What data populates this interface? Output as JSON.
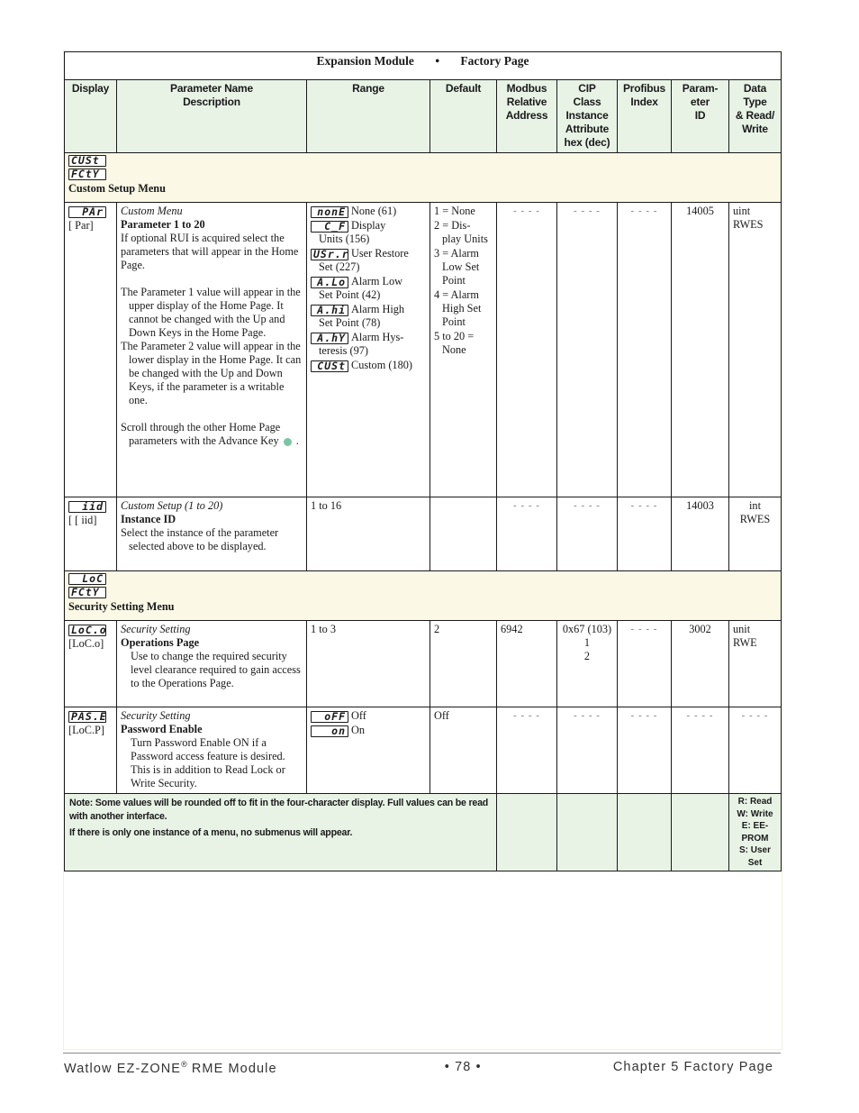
{
  "table_title": {
    "left": "Expansion Module",
    "separator": "•",
    "right": "Factory Page"
  },
  "columns": [
    "Display",
    "Parameter Name\nDescription",
    "Range",
    "Default",
    "Modbus\nRelative\nAddress",
    "CIP\nClass\nInstance\nAttribute\nhex (dec)",
    "Profibus\nIndex",
    "Param-\neter\nID",
    "Data\nType\n& Read/\nWrite"
  ],
  "column_labels": {
    "display": "Display",
    "param_name_1": "Parameter Name",
    "param_name_2": "Description",
    "range": "Range",
    "default": "Default",
    "modbus_1": "Modbus",
    "modbus_2": "Relative",
    "modbus_3": "Address",
    "cip_1": "CIP",
    "cip_2": "Class",
    "cip_3": "Instance",
    "cip_4": "Attribute",
    "cip_5": "hex (dec)",
    "profibus_1": "Profibus",
    "profibus_2": "Index",
    "paramid_1": "Param-",
    "paramid_2": "eter",
    "paramid_3": "ID",
    "datatype_1": "Data",
    "datatype_2": "Type",
    "datatype_3": "& Read/",
    "datatype_4": "Write"
  },
  "menus": [
    {
      "display_top": "CUSt",
      "display_bottom": "FCtY",
      "title": "Custom Setup Menu"
    },
    {
      "display_top": "LoC",
      "display_bottom": "FCtY",
      "title": "Security Setting Menu"
    }
  ],
  "rows": {
    "par": {
      "display": "PAr",
      "display_bracket": "[ Par]",
      "menu_name": "Custom Menu",
      "param_name": "Parameter 1 to 20",
      "desc_intro": "If optional RUI is acquired select the parameters that will appear in the Home Page.",
      "desc_p1": "The Parameter 1 value will appear in the upper display of the Home Page. It cannot be changed with the Up and Down Keys in the Home Page.",
      "desc_p2": "The Parameter 2 value will appear in the lower display in the Home Page. It can be changed with the Up and Down Keys, if the parameter is a writable one.",
      "desc_p3": "Scroll through the other Home Page parameters with the Advance Key",
      "desc_p3_end": ".",
      "advance_key_icon": "advance-key-icon",
      "range": [
        {
          "seg": "nonE",
          "text": "None (61)",
          "cont": ""
        },
        {
          "seg": "C_F",
          "text": "Display",
          "cont": "Units (156)"
        },
        {
          "seg": "USr.r",
          "text": "User Restore",
          "cont": "Set (227)"
        },
        {
          "seg": "A.Lo",
          "text": "Alarm Low",
          "cont": "Set Point (42)"
        },
        {
          "seg": "A.hi",
          "text": "Alarm High",
          "cont": "Set Point (78)"
        },
        {
          "seg": "A.hY",
          "text": "Alarm Hys-",
          "cont": "teresis (97)"
        },
        {
          "seg": "CUSt",
          "text": "Custom (180)",
          "cont": ""
        }
      ],
      "default": [
        {
          "text": "1 = None",
          "cont": ""
        },
        {
          "text": "2 = Dis-",
          "cont": "play Units"
        },
        {
          "text": "3 = Alarm",
          "cont": "Low Set Point"
        },
        {
          "text": "4 = Alarm",
          "cont": "High Set Point"
        },
        {
          "text": "5 to 20 =",
          "cont": "None"
        }
      ],
      "modbus": "- - - -",
      "cip": "- - - -",
      "profibus": "- - - -",
      "param_id": "14005",
      "data_type": "uint",
      "rw": "RWES"
    },
    "iid": {
      "display": "iid",
      "display_bracket": "[ [ iid]",
      "menu_name": "Custom Setup (1 to 20)",
      "param_name": "Instance ID",
      "desc": "Select the instance of the parameter selected above to be displayed.",
      "range": "1 to 16",
      "default": "",
      "modbus": "- - - -",
      "cip": "- - - -",
      "profibus": "- - - -",
      "param_id": "14003",
      "data_type": "int",
      "rw": "RWES"
    },
    "loco": {
      "display": "LoC.o",
      "display_bracket": "[LoC.o]",
      "menu_name": "Security Setting",
      "param_name": "Operations Page",
      "desc": "Use to change the required security level clearance required to gain access to the Operations Page.",
      "range": "1 to 3",
      "default": "2",
      "modbus": "6942",
      "cip_1": "0x67 (103)",
      "cip_2": "1",
      "cip_3": "2",
      "profibus": "- - - -",
      "param_id": "3002",
      "data_type": "unit",
      "rw": "RWE"
    },
    "pase": {
      "display": "PAS.E",
      "display_bracket": "[LoC.P]",
      "menu_name": "Security Setting",
      "param_name": "Password Enable",
      "desc": "Turn Password Enable ON if a Password access feature is desired. This is in addition to Read Lock or Write Security.",
      "range": [
        {
          "seg": "oFF",
          "text": "Off"
        },
        {
          "seg": "on",
          "text": "On"
        }
      ],
      "default": "Off",
      "modbus": "- - - -",
      "cip": "- - - -",
      "profibus": "- - - -",
      "param_id": "- - - -",
      "data_type": "- - - -"
    }
  },
  "notes": {
    "line1": "Note: Some values will be rounded off to fit in the four-character display. Full values can be read with another interface.",
    "line2": "If there is only one instance of a menu, no submenus will appear.",
    "legend": [
      "R: Read",
      "W: Write",
      "E: EE-",
      "PROM",
      "S: User",
      "Set"
    ]
  },
  "footer": {
    "product": "Watlow EZ-ZONE",
    "registered": "®",
    "product_suffix": " RME Module",
    "page": "•  78  •",
    "chapter": "Chapter 5 Factory Page"
  },
  "colors": {
    "header_bg": "#e8f3e6",
    "menu_bg": "#fbf8e6",
    "note_bg": "#e8f3e6",
    "advance_key": "#7bc5a3"
  }
}
